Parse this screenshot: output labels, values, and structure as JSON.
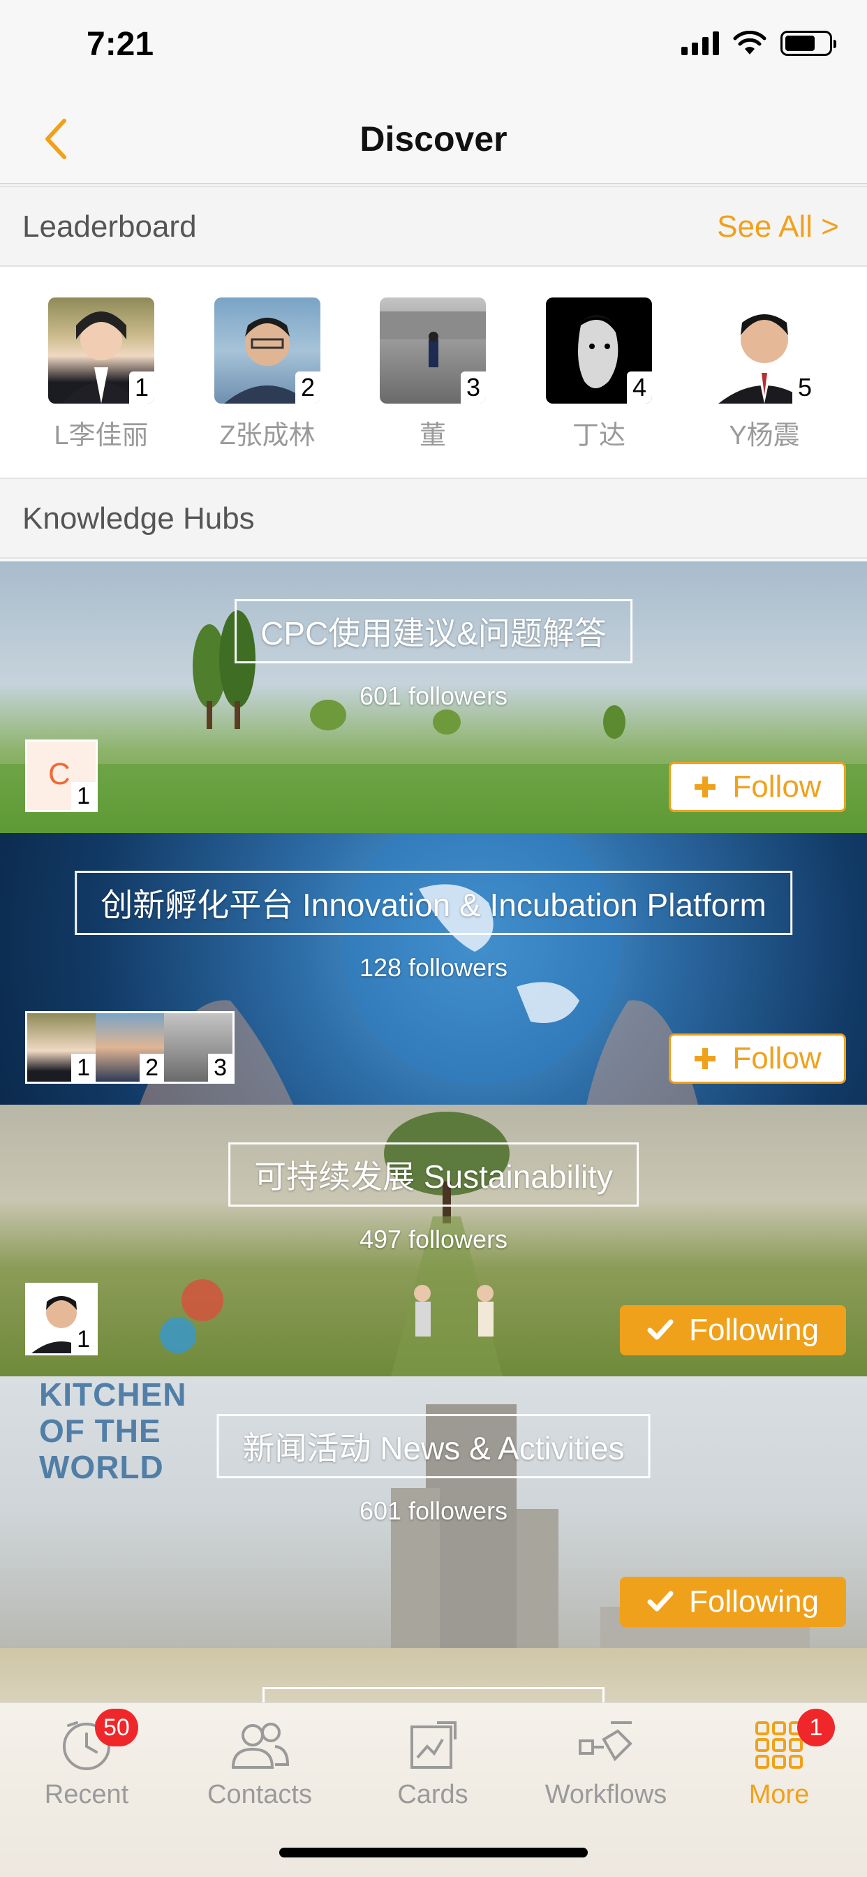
{
  "status_bar": {
    "time": "7:21"
  },
  "nav": {
    "title": "Discover"
  },
  "leaderboard": {
    "title": "Leaderboard",
    "see_all": "See All >",
    "leaders": [
      {
        "rank": "1",
        "name": "L李佳丽"
      },
      {
        "rank": "2",
        "name": "Z张成林"
      },
      {
        "rank": "3",
        "name": "董"
      },
      {
        "rank": "4",
        "name": "丁达"
      },
      {
        "rank": "5",
        "name": "Y杨震"
      }
    ]
  },
  "knowledge_hubs": {
    "title": "Knowledge Hubs",
    "hubs": [
      {
        "title": "CPC使用建议&问题解答",
        "followers": "601 followers",
        "button": "Follow",
        "button_state": "follow",
        "members": [
          {
            "initial": "C",
            "rank": "1"
          }
        ]
      },
      {
        "title": "创新孵化平台  Innovation & Incubation Platform",
        "followers": "128 followers",
        "button": "Follow",
        "button_state": "follow",
        "members": [
          {
            "rank": "1"
          },
          {
            "rank": "2"
          },
          {
            "rank": "3"
          }
        ]
      },
      {
        "title": "可持续发展 Sustainability",
        "followers": "497 followers",
        "button": "Following",
        "button_state": "following",
        "members": [
          {
            "rank": "1"
          }
        ]
      },
      {
        "title": "新闻活动 News & Activities",
        "followers": "601 followers",
        "button": "Following",
        "button_state": "following",
        "overlay_text": "KITCHEN OF THE WORLD",
        "members": []
      }
    ]
  },
  "tab_bar": {
    "tabs": [
      {
        "label": "Recent",
        "icon": "clock-icon",
        "badge": "50"
      },
      {
        "label": "Contacts",
        "icon": "people-icon"
      },
      {
        "label": "Cards",
        "icon": "cards-icon"
      },
      {
        "label": "Workflows",
        "icon": "workflow-icon"
      },
      {
        "label": "More",
        "icon": "grid-icon",
        "badge": "1",
        "active": true
      }
    ]
  },
  "colors": {
    "accent": "#f0a11c",
    "badge": "#f0272a",
    "muted": "#9a9a9a"
  }
}
